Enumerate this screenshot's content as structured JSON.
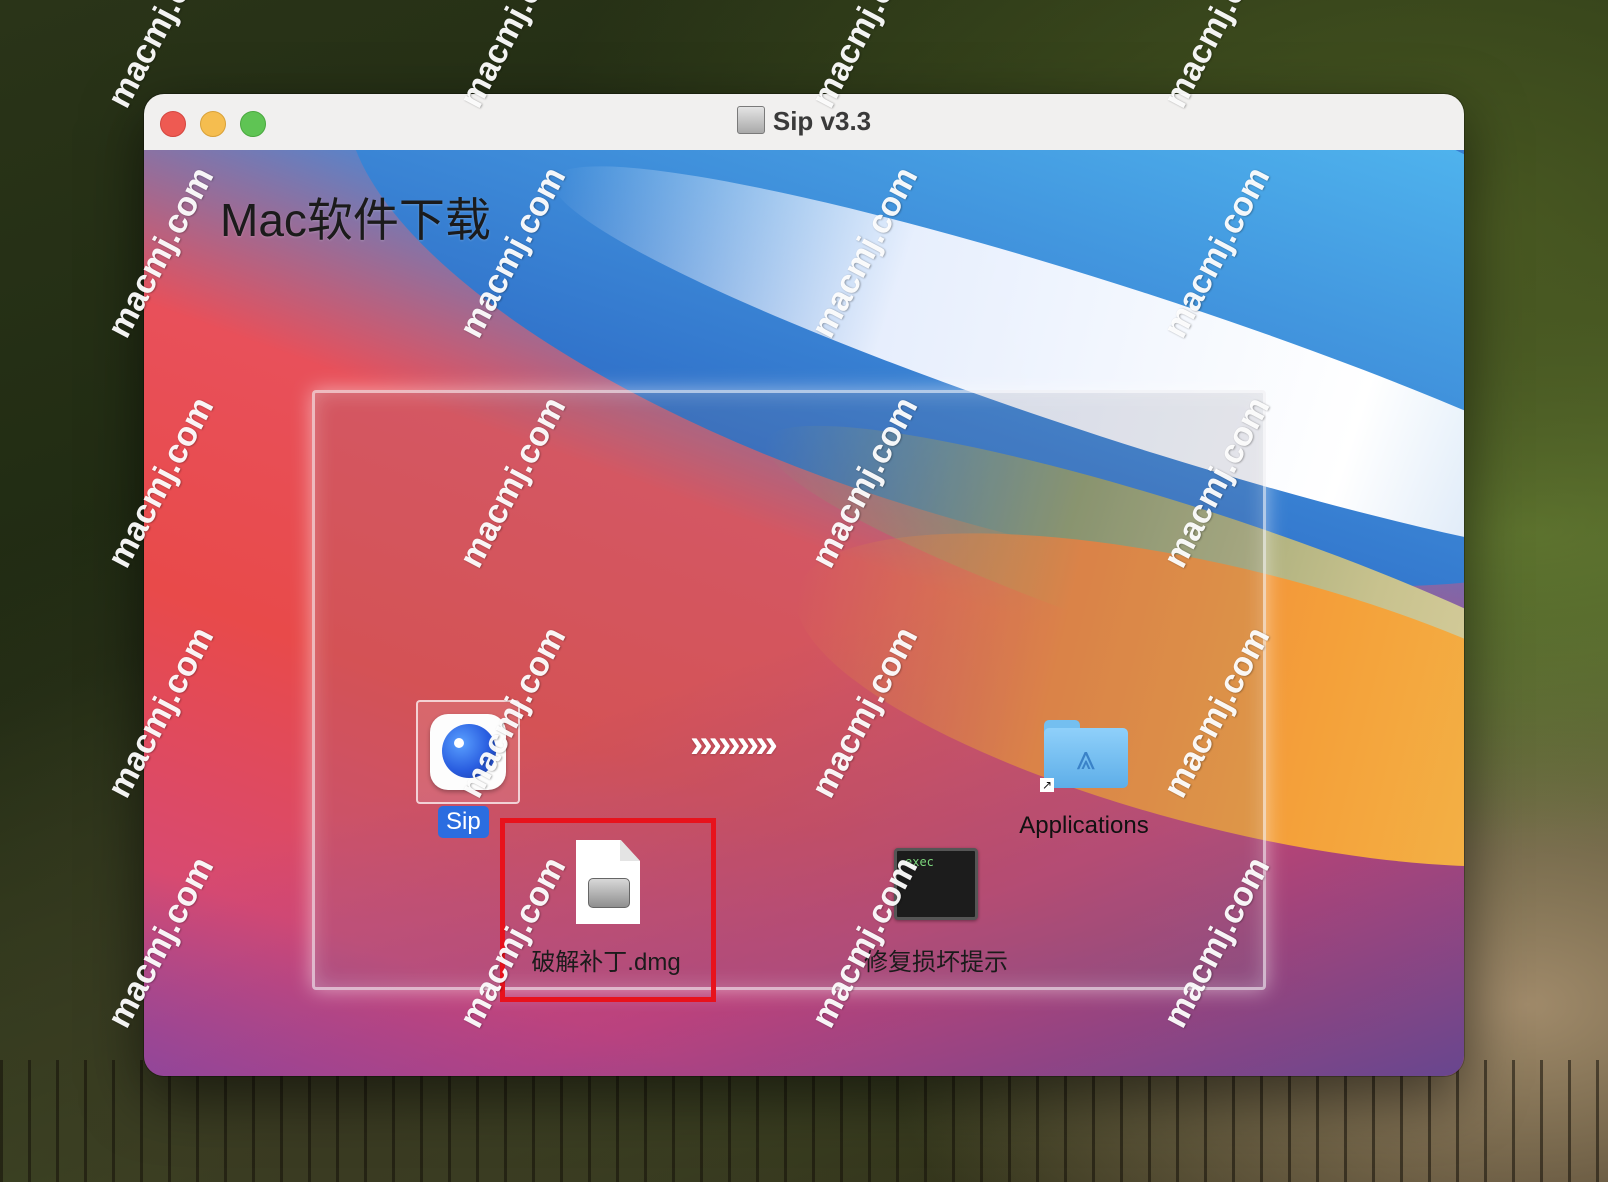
{
  "window": {
    "title": "Sip v3.3",
    "heading": "Mac软件下载"
  },
  "items": {
    "app": {
      "label": "Sip",
      "icon": "sip-app-icon"
    },
    "arrows": "›››››››››",
    "applications": {
      "label": "Applications",
      "icon": "applications-folder-icon"
    },
    "patch": {
      "label": "破解补丁.dmg",
      "icon": "dmg-disk-image-icon"
    },
    "repair": {
      "label": "修复损坏提示",
      "icon": "exec-terminal-icon",
      "icon_text": "exec"
    }
  },
  "watermark": "macmj.com",
  "colors": {
    "highlight": "#e8121c",
    "app_label_bg": "#2b6de0"
  }
}
